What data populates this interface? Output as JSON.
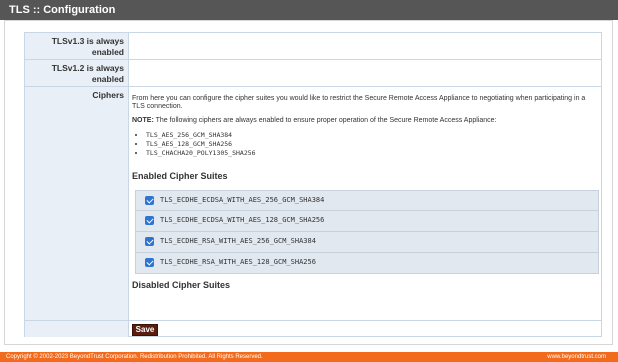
{
  "page": {
    "title": "TLS :: Configuration"
  },
  "rows": {
    "tls13": {
      "label": "TLSv1.3 is always enabled"
    },
    "tls12": {
      "label": "TLSv1.2 is always enabled"
    },
    "ciphers": {
      "label": "Ciphers",
      "description": "From here you can configure the cipher suites you would like to restrict the Secure Remote Access Appliance to negotiating when participating in a TLS connection.",
      "note_label": "NOTE:",
      "note_text": " The following ciphers are always enabled to ensure proper operation of the Secure Remote Access Appliance:",
      "always_enabled": [
        "TLS_AES_256_GCM_SHA384",
        "TLS_AES_128_GCM_SHA256",
        "TLS_CHACHA20_POLY1305_SHA256"
      ],
      "enabled_heading": "Enabled Cipher Suites",
      "enabled_suites": [
        {
          "name": "TLS_ECDHE_ECDSA_WITH_AES_256_GCM_SHA384",
          "checked": true
        },
        {
          "name": "TLS_ECDHE_ECDSA_WITH_AES_128_GCM_SHA256",
          "checked": true
        },
        {
          "name": "TLS_ECDHE_RSA_WITH_AES_256_GCM_SHA384",
          "checked": true
        },
        {
          "name": "TLS_ECDHE_RSA_WITH_AES_128_GCM_SHA256",
          "checked": true
        }
      ],
      "disabled_heading": "Disabled Cipher Suites"
    }
  },
  "actions": {
    "save_label": "Save"
  },
  "footer": {
    "copyright": "Copyright © 2002-2023 BeyondTrust Corporation. Redistribution Prohibited. All Rights Reserved.",
    "link": "www.beyondtrust.com"
  },
  "colors": {
    "title_bar": "#565656",
    "label_cell": "#e9eff6",
    "checkbox": "#2f74d0",
    "save_button": "#5a1e0f",
    "footer": "#f26b1d"
  }
}
